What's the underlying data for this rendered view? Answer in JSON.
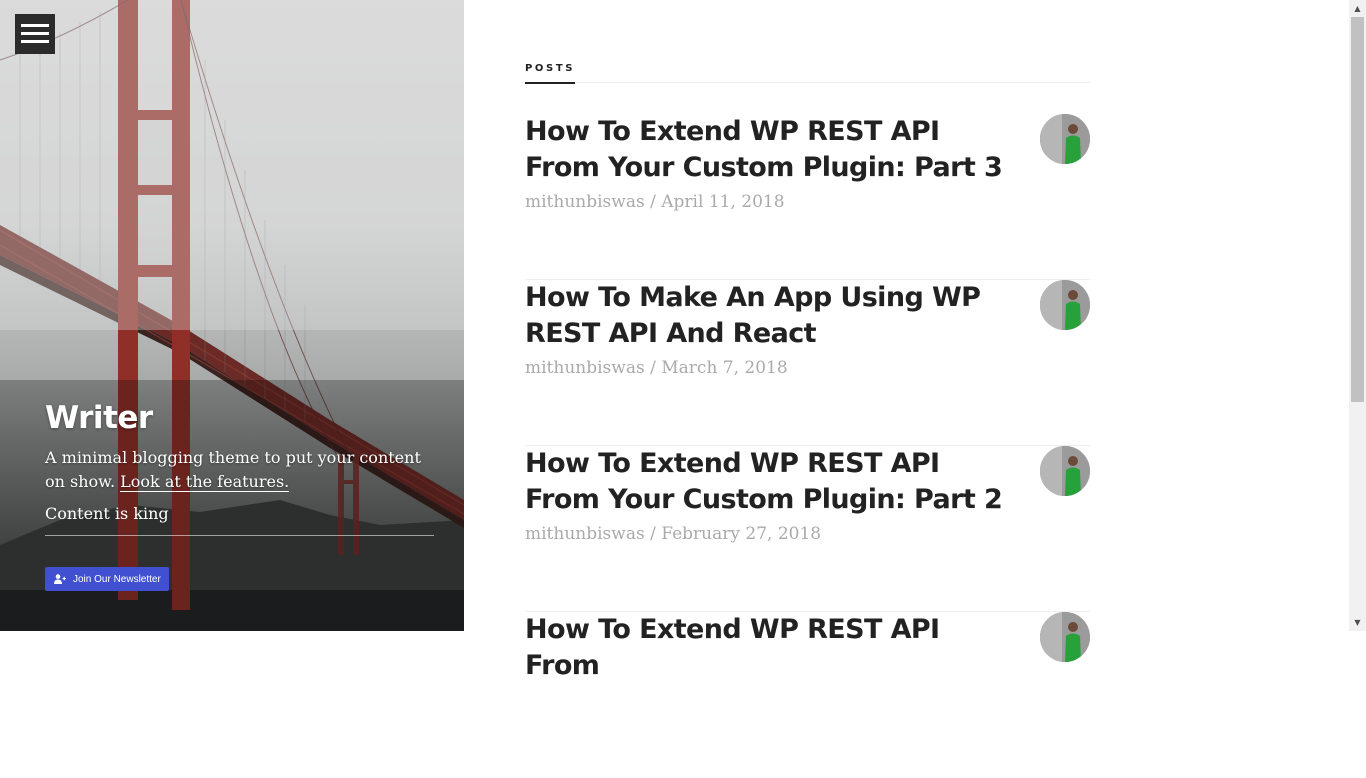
{
  "site": {
    "title": "Writer",
    "description": "A minimal blogging theme to put your content on show.",
    "features_link": "Look at the features.",
    "tagline": "Content is king",
    "newsletter_button": "Join Our Newsletter"
  },
  "menu": {
    "icon": "hamburger-menu-icon"
  },
  "posts_section": {
    "label": "POSTS",
    "items": [
      {
        "title": "How To Extend WP REST API From Your Custom Plugin: Part 3",
        "author": "mithunbiswas",
        "date": "April 11, 2018"
      },
      {
        "title": "How To Make An App Using WP REST API And React",
        "author": "mithunbiswas",
        "date": "March 7, 2018"
      },
      {
        "title": "How To Extend WP REST API From Your Custom Plugin: Part 2",
        "author": "mithunbiswas",
        "date": "February 27, 2018"
      },
      {
        "title": "How To Extend WP REST API From",
        "author": "",
        "date": ""
      }
    ]
  },
  "meta_separator": "/",
  "colors": {
    "newsletter": "#4050d0",
    "title_text": "#222222",
    "meta_text": "#aaaaaa"
  }
}
